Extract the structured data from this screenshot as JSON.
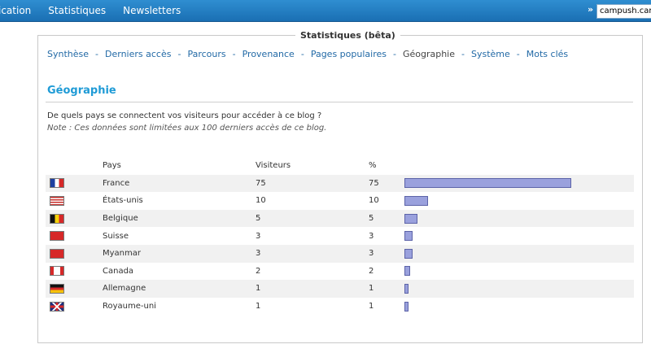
{
  "topnav": {
    "items": [
      "ication",
      "Statistiques",
      "Newsletters"
    ],
    "arrow": "»",
    "blog_field": "campush.cana"
  },
  "panel": {
    "title": "Statistiques (bêta)",
    "tabs": [
      "Synthèse",
      "Derniers accès",
      "Parcours",
      "Provenance",
      "Pages populaires",
      "Géographie",
      "Système",
      "Mots clés"
    ],
    "tab_separator": "-",
    "active_tab": "Géographie"
  },
  "section": {
    "title": "Géographie",
    "question": "De quels pays se connectent vos visiteurs pour accéder à ce blog ?",
    "note": "Note : Ces données sont limitées aux 100 derniers accès de ce blog."
  },
  "table": {
    "headers": {
      "country": "Pays",
      "visitors": "Visiteurs",
      "percent": "%"
    },
    "rows": [
      {
        "country": "France",
        "flag": "flag-france",
        "visitors": "75",
        "percent": "75",
        "share": 75
      },
      {
        "country": "États-unis",
        "flag": "flag-usa",
        "visitors": "10",
        "percent": "10",
        "share": 10
      },
      {
        "country": "Belgique",
        "flag": "flag-belgium",
        "visitors": "5",
        "percent": "5",
        "share": 5
      },
      {
        "country": "Suisse",
        "flag": "flag-switzerland",
        "visitors": "3",
        "percent": "3",
        "share": 3
      },
      {
        "country": "Myanmar",
        "flag": "flag-myanmar",
        "visitors": "3",
        "percent": "3",
        "share": 3
      },
      {
        "country": "Canada",
        "flag": "flag-canada",
        "visitors": "2",
        "percent": "2",
        "share": 2
      },
      {
        "country": "Allemagne",
        "flag": "flag-germany",
        "visitors": "1",
        "percent": "1",
        "share": 1
      },
      {
        "country": "Royaume-uni",
        "flag": "flag-uk",
        "visitors": "1",
        "percent": "1",
        "share": 1
      }
    ]
  },
  "colors": {
    "topbar": "#1f7cc2",
    "link": "#236aa6",
    "section_title": "#1f9bd6",
    "bar_fill": "#9aa1dd"
  }
}
